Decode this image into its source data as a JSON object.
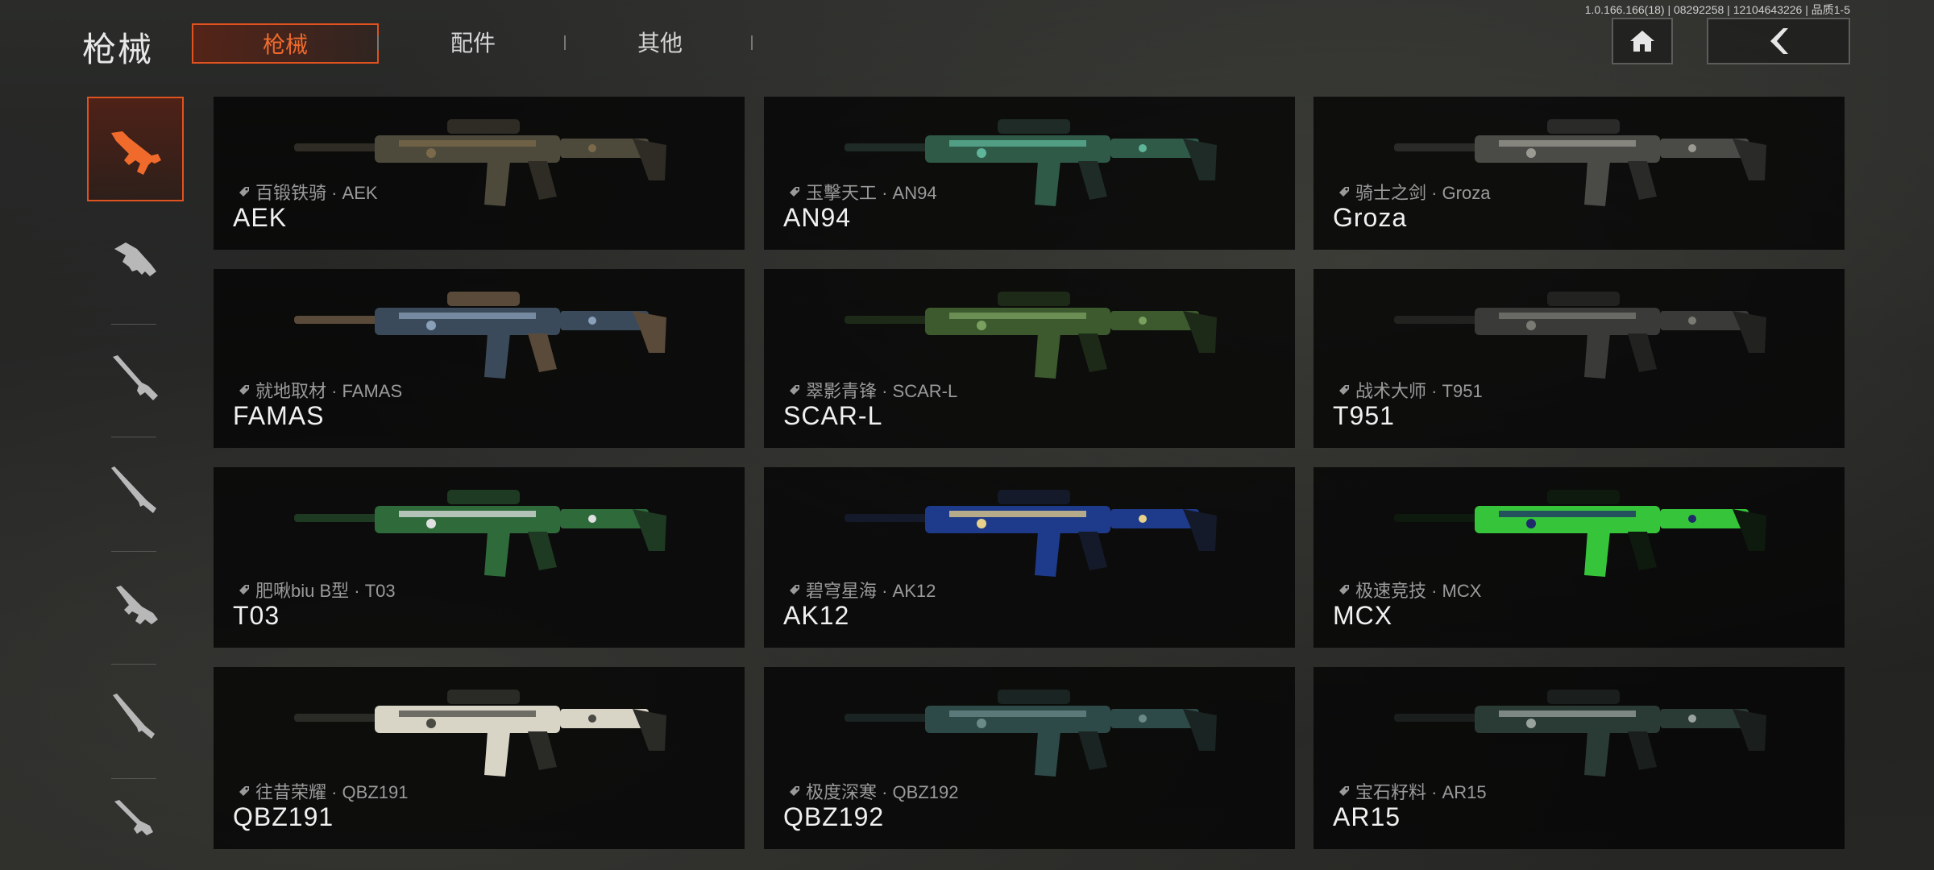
{
  "header": {
    "title": "枪械",
    "tabs": [
      {
        "label": "枪械",
        "active": true
      },
      {
        "label": "配件",
        "active": false
      },
      {
        "label": "其他",
        "active": false
      }
    ],
    "version": "1.0.166.166(18) | 08292258 | 12104643226 | 品质1-5",
    "home_icon": "home-icon",
    "back_icon": "back-arrow-icon"
  },
  "sidebar": {
    "items": [
      {
        "icon": "assault-rifle-icon",
        "active": true
      },
      {
        "icon": "smg-icon",
        "active": false
      },
      {
        "icon": "sniper-rifle-icon",
        "active": false
      },
      {
        "icon": "marksman-rifle-icon",
        "active": false
      },
      {
        "icon": "light-machine-gun-icon",
        "active": false
      },
      {
        "icon": "shotgun-icon",
        "active": false
      },
      {
        "icon": "pistol-icon",
        "active": false
      }
    ]
  },
  "weapons": [
    {
      "name": "AEK",
      "skin": "百锻铁骑 · AEK",
      "colors": [
        "#4d4a3c",
        "#7a6a4a",
        "#2e2c24"
      ]
    },
    {
      "name": "AN94",
      "skin": "玉擊天工 · AN94",
      "colors": [
        "#2f5a48",
        "#5fb59a",
        "#1f2b27"
      ]
    },
    {
      "name": "Groza",
      "skin": "骑士之剑 · Groza",
      "colors": [
        "#4a4a46",
        "#9a9a92",
        "#2a2a28"
      ]
    },
    {
      "name": "FAMAS",
      "skin": "就地取材 · FAMAS",
      "colors": [
        "#3b4a5a",
        "#8aa0b8",
        "#5a4a3a"
      ]
    },
    {
      "name": "SCAR-L",
      "skin": "翠影青锋 · SCAR-L",
      "colors": [
        "#3c5a2e",
        "#7aa060",
        "#1e2a18"
      ]
    },
    {
      "name": "T951",
      "skin": "战术大师 · T951",
      "colors": [
        "#3a3a38",
        "#7a7a74",
        "#222220"
      ]
    },
    {
      "name": "T03",
      "skin": "肥啾biu B型 · T03",
      "colors": [
        "#2e6a3a",
        "#e0e0e0",
        "#1e3a22"
      ]
    },
    {
      "name": "AK12",
      "skin": "碧穹星海 · AK12",
      "colors": [
        "#1e3a8a",
        "#e8d28a",
        "#151a2a"
      ]
    },
    {
      "name": "MCX",
      "skin": "极速竞技 · MCX",
      "colors": [
        "#36c53a",
        "#1e2a6a",
        "#0e1a0e"
      ]
    },
    {
      "name": "QBZ191",
      "skin": "往昔荣耀 · QBZ191",
      "colors": [
        "#d8d4c6",
        "#4a4a44",
        "#2a2a26"
      ]
    },
    {
      "name": "QBZ192",
      "skin": "极度深寒 · QBZ192",
      "colors": [
        "#2e4a48",
        "#6a8a88",
        "#1a2422"
      ]
    },
    {
      "name": "AR15",
      "skin": "宝石籽料 · AR15",
      "colors": [
        "#2a3a34",
        "#9aa29e",
        "#1a1e1c"
      ]
    }
  ]
}
